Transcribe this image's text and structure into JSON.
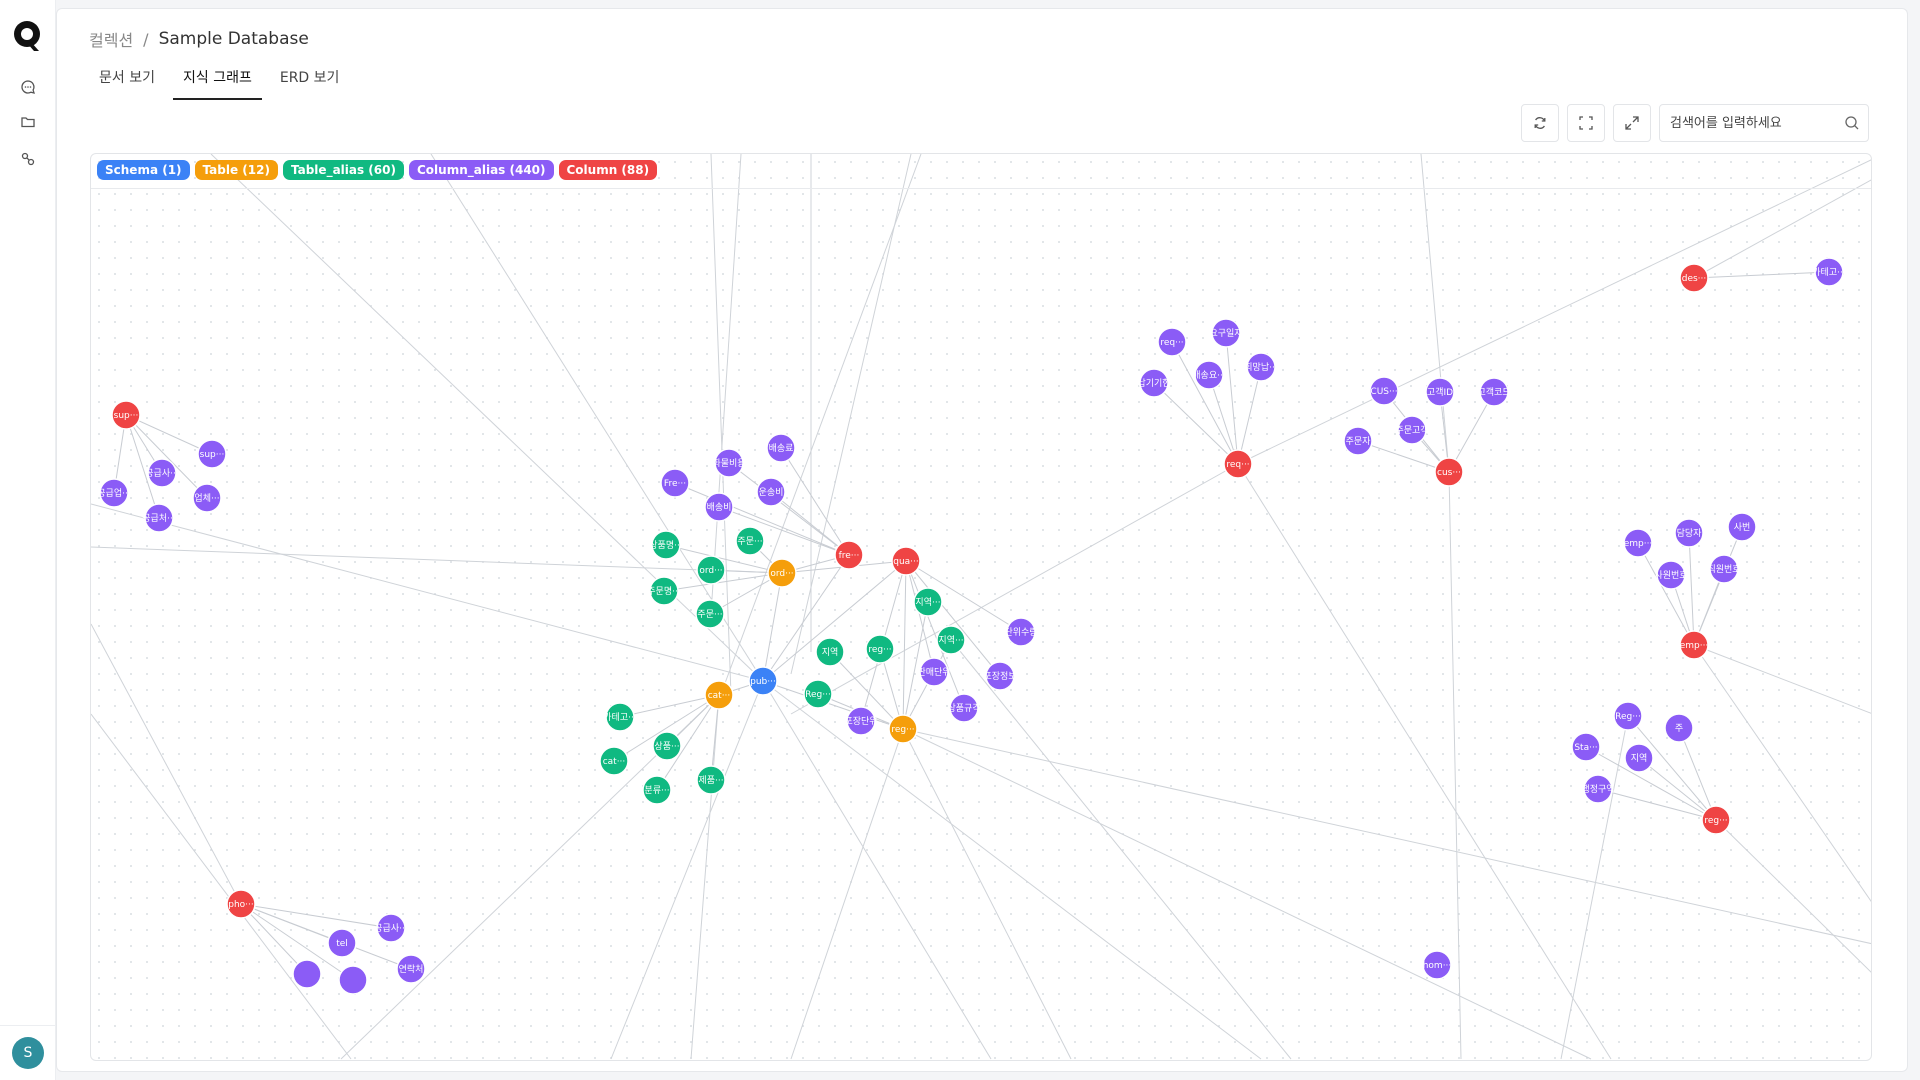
{
  "app": {
    "logo_icon": "q-logo-icon",
    "user_initial": "S"
  },
  "rail": {
    "items": [
      {
        "name": "chat-icon"
      },
      {
        "name": "folder-icon"
      },
      {
        "name": "graph-icon"
      }
    ]
  },
  "breadcrumb": {
    "parent": "컬렉션",
    "separator": "/",
    "current": "Sample Database"
  },
  "tabs": [
    {
      "label": "문서 보기",
      "active": false
    },
    {
      "label": "지식 그래프",
      "active": true
    },
    {
      "label": "ERD 보기",
      "active": false
    }
  ],
  "toolbar": {
    "refresh_icon": "refresh-icon",
    "fit_icon": "fit-screen-icon",
    "expand_icon": "expand-icon",
    "search_placeholder": "검색어를 입력하세요",
    "search_icon": "search-icon"
  },
  "colors": {
    "Schema": "#3b82f6",
    "Table": "#f59e0b",
    "Table_alias": "#10b981",
    "Column_alias": "#8b5cf6",
    "Column": "#ef4444"
  },
  "legend": [
    {
      "key": "Schema",
      "label": "Schema (1)"
    },
    {
      "key": "Table",
      "label": "Table (12)"
    },
    {
      "key": "Table_alias",
      "label": "Table_alias (60)"
    },
    {
      "key": "Column_alias",
      "label": "Column_alias (440)"
    },
    {
      "key": "Column",
      "label": "Column (88)"
    }
  ],
  "graph": {
    "nodes": [
      {
        "id": "pub",
        "label": "pub···",
        "type": "Schema"
      },
      {
        "id": "ord",
        "label": "ord···",
        "type": "Table"
      },
      {
        "id": "cat",
        "label": "cat···",
        "type": "Table"
      },
      {
        "id": "regT",
        "label": "reg···",
        "type": "Table"
      },
      {
        "id": "ta1",
        "label": "상품명···",
        "type": "Table_alias"
      },
      {
        "id": "ta2",
        "label": "ord···",
        "type": "Table_alias"
      },
      {
        "id": "ta3",
        "label": "주문···",
        "type": "Table_alias"
      },
      {
        "id": "ta4",
        "label": "주문명···",
        "type": "Table_alias"
      },
      {
        "id": "ta5",
        "label": "주문···",
        "type": "Table_alias"
      },
      {
        "id": "ta6",
        "label": "지역",
        "type": "Table_alias"
      },
      {
        "id": "ta7",
        "label": "reg···",
        "type": "Table_alias"
      },
      {
        "id": "ta8",
        "label": "Reg···",
        "type": "Table_alias"
      },
      {
        "id": "ta9",
        "label": "지역···",
        "type": "Table_alias"
      },
      {
        "id": "ta10",
        "label": "지역···",
        "type": "Table_alias"
      },
      {
        "id": "ta11",
        "label": "카테고···",
        "type": "Table_alias"
      },
      {
        "id": "ta12",
        "label": "상품···",
        "type": "Table_alias"
      },
      {
        "id": "ta13",
        "label": "cat···",
        "type": "Table_alias"
      },
      {
        "id": "ta14",
        "label": "분류···",
        "type": "Table_alias"
      },
      {
        "id": "ta15",
        "label": "제품···",
        "type": "Table_alias"
      },
      {
        "id": "ca1",
        "label": "Fre···",
        "type": "Column_alias"
      },
      {
        "id": "ca2",
        "label": "화물비용",
        "type": "Column_alias"
      },
      {
        "id": "ca3",
        "label": "배송료",
        "type": "Column_alias"
      },
      {
        "id": "ca4",
        "label": "운송비",
        "type": "Column_alias"
      },
      {
        "id": "ca5",
        "label": "배송비",
        "type": "Column_alias"
      },
      {
        "id": "ca6",
        "label": "판매단위",
        "type": "Column_alias"
      },
      {
        "id": "ca7",
        "label": "포장정보",
        "type": "Column_alias"
      },
      {
        "id": "ca8",
        "label": "단위수량",
        "type": "Column_alias"
      },
      {
        "id": "ca9",
        "label": "포장단위",
        "type": "Column_alias"
      },
      {
        "id": "ca10",
        "label": "상품규격",
        "type": "Column_alias"
      },
      {
        "id": "ca11",
        "label": "sup···",
        "type": "Column_alias"
      },
      {
        "id": "ca12",
        "label": "공급사···",
        "type": "Column_alias"
      },
      {
        "id": "ca13",
        "label": "업체···",
        "type": "Column_alias"
      },
      {
        "id": "ca14",
        "label": "공급업···",
        "type": "Column_alias"
      },
      {
        "id": "ca15",
        "label": "공급처···",
        "type": "Column_alias"
      },
      {
        "id": "ca16",
        "label": "req···",
        "type": "Column_alias"
      },
      {
        "id": "ca17",
        "label": "요구일자",
        "type": "Column_alias"
      },
      {
        "id": "ca18",
        "label": "배송요···",
        "type": "Column_alias"
      },
      {
        "id": "ca19",
        "label": "희망납···",
        "type": "Column_alias"
      },
      {
        "id": "ca20",
        "label": "납기기한",
        "type": "Column_alias"
      },
      {
        "id": "ca21",
        "label": "CUS···",
        "type": "Column_alias"
      },
      {
        "id": "ca22",
        "label": "고객ID",
        "type": "Column_alias"
      },
      {
        "id": "ca23",
        "label": "고객코드",
        "type": "Column_alias"
      },
      {
        "id": "ca24",
        "label": "주문고객",
        "type": "Column_alias"
      },
      {
        "id": "ca25",
        "label": "주문자",
        "type": "Column_alias"
      },
      {
        "id": "ca26",
        "label": "emp···",
        "type": "Column_alias"
      },
      {
        "id": "ca27",
        "label": "담당자",
        "type": "Column_alias"
      },
      {
        "id": "ca28",
        "label": "사번",
        "type": "Column_alias"
      },
      {
        "id": "ca29",
        "label": "사원번호",
        "type": "Column_alias"
      },
      {
        "id": "ca30",
        "label": "직원번호",
        "type": "Column_alias"
      },
      {
        "id": "ca31",
        "label": "Reg···",
        "type": "Column_alias"
      },
      {
        "id": "ca32",
        "label": "주",
        "type": "Column_alias"
      },
      {
        "id": "ca33",
        "label": "Sta···",
        "type": "Column_alias"
      },
      {
        "id": "ca34",
        "label": "지역",
        "type": "Column_alias"
      },
      {
        "id": "ca35",
        "label": "행정구역",
        "type": "Column_alias"
      },
      {
        "id": "ca36",
        "label": "공급사···",
        "type": "Column_alias"
      },
      {
        "id": "ca37",
        "label": "tel",
        "type": "Column_alias"
      },
      {
        "id": "ca38",
        "label": "연락처",
        "type": "Column_alias"
      },
      {
        "id": "ca39",
        "label": "hom···",
        "type": "Column_alias"
      },
      {
        "id": "ca40",
        "label": "카테고···",
        "type": "Column_alias"
      },
      {
        "id": "ca41",
        "label": "",
        "type": "Column_alias"
      },
      {
        "id": "ca42",
        "label": "",
        "type": "Column_alias"
      },
      {
        "id": "c1",
        "label": "fre···",
        "type": "Column"
      },
      {
        "id": "c2",
        "label": "qua···",
        "type": "Column"
      },
      {
        "id": "c3",
        "label": "sup···",
        "type": "Column"
      },
      {
        "id": "c4",
        "label": "req···",
        "type": "Column"
      },
      {
        "id": "c5",
        "label": "cus···",
        "type": "Column"
      },
      {
        "id": "c6",
        "label": "emp···",
        "type": "Column"
      },
      {
        "id": "c7",
        "label": "reg···",
        "type": "Column"
      },
      {
        "id": "c8",
        "label": "pho···",
        "type": "Column"
      },
      {
        "id": "c9",
        "label": "des···",
        "type": "Column"
      }
    ]
  }
}
